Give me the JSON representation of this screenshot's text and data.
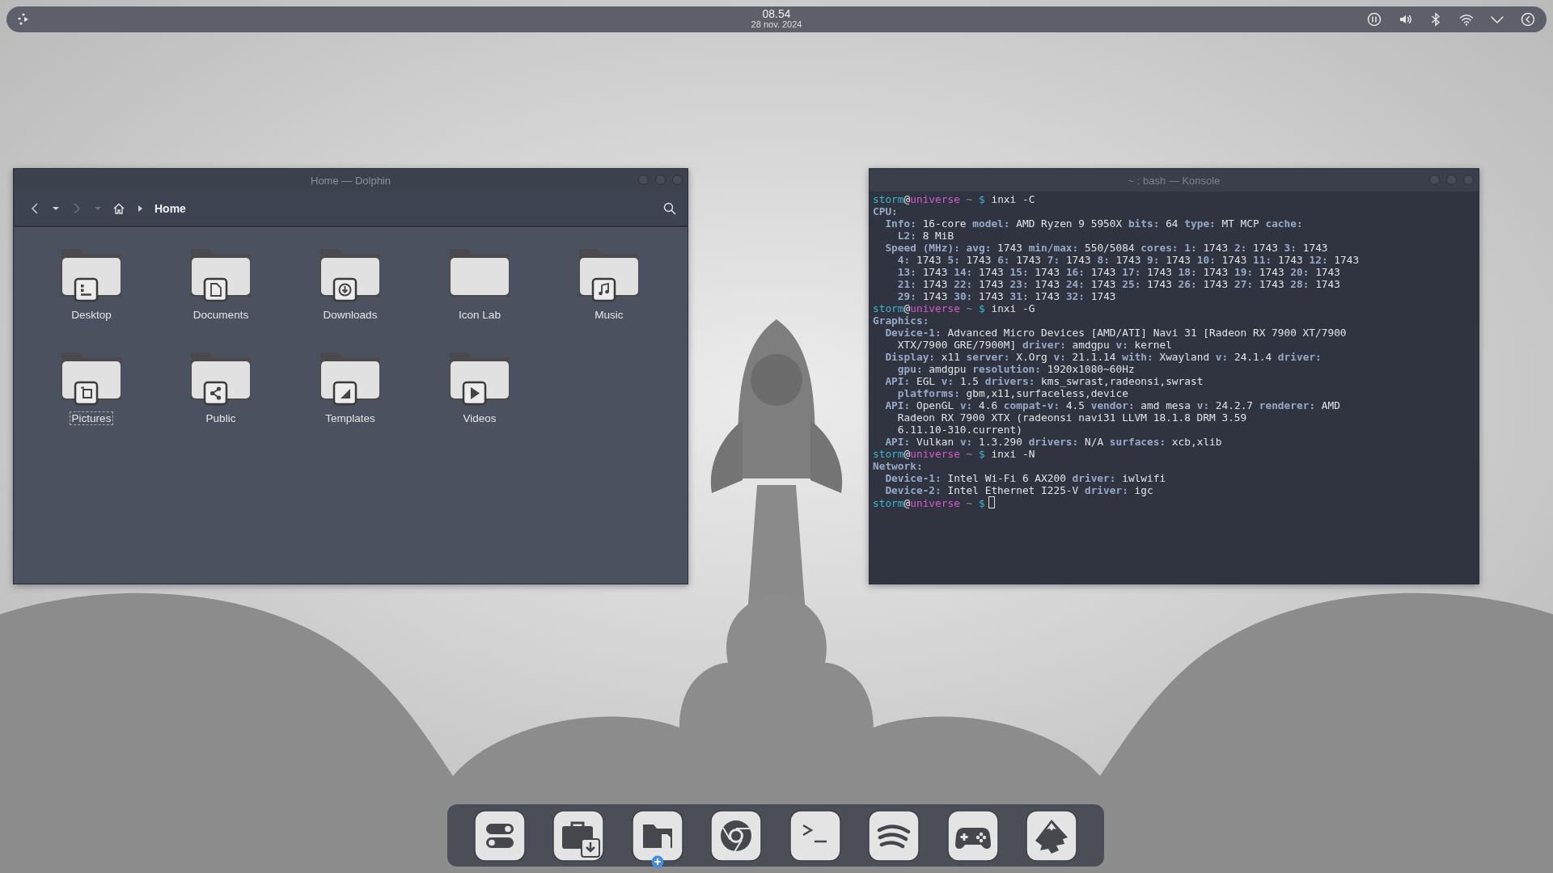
{
  "top_panel": {
    "clock": {
      "time": "08.54",
      "date": "28 nov. 2024"
    }
  },
  "dolphin": {
    "title": "Home — Dolphin",
    "navigation": {
      "back": {
        "disabled": false
      },
      "forward": {
        "disabled": true
      }
    },
    "location": "Home",
    "folders": [
      {
        "label": "Desktop",
        "kind": "desktop",
        "focused": false
      },
      {
        "label": "Documents",
        "kind": "document",
        "focused": false
      },
      {
        "label": "Downloads",
        "kind": "download",
        "focused": false
      },
      {
        "label": "Icon Lab",
        "kind": "plain",
        "focused": false
      },
      {
        "label": "Music",
        "kind": "music",
        "focused": false
      },
      {
        "label": "Pictures",
        "kind": "picture",
        "focused": true
      },
      {
        "label": "Public",
        "kind": "share",
        "focused": false
      },
      {
        "label": "Templates",
        "kind": "template",
        "focused": false
      },
      {
        "label": "Videos",
        "kind": "video",
        "focused": false
      }
    ]
  },
  "konsole": {
    "title": "~ : bash — Konsole",
    "lines": [
      {
        "kind": "prompt",
        "user": "storm",
        "separator": "@",
        "host": "universe",
        "path": "~",
        "symbol": "$",
        "command": "inxi -C",
        "cursor": false
      },
      {
        "kind": "heading",
        "text": "CPU:"
      },
      {
        "kind": "item",
        "text": "**Info:** 16-core **model:** AMD Ryzen 9 5950X **bits:** 64 **type:** MT MCP **cache:**"
      },
      {
        "kind": "continuation",
        "text": "**L2:** 8 MiB"
      },
      {
        "kind": "item",
        "text": "**Speed (MHz):** **avg:** 1743 **min/max:** 550/5084 **cores:** **1:** 1743 **2:** 1743 **3:** 1743"
      },
      {
        "kind": "continuation",
        "text": "**4:** 1743 **5:** 1743 **6:** 1743 **7:** 1743 **8:** 1743 **9:** 1743 **10:** 1743 **11:** 1743 **12:** 1743"
      },
      {
        "kind": "continuation",
        "text": "**13:** 1743 **14:** 1743 **15:** 1743 **16:** 1743 **17:** 1743 **18:** 1743 **19:** 1743 **20:** 1743"
      },
      {
        "kind": "continuation",
        "text": "**21:** 1743 **22:** 1743 **23:** 1743 **24:** 1743 **25:** 1743 **26:** 1743 **27:** 1743 **28:** 1743"
      },
      {
        "kind": "continuation",
        "text": "**29:** 1743 **30:** 1743 **31:** 1743 **32:** 1743"
      },
      {
        "kind": "prompt",
        "user": "storm",
        "separator": "@",
        "host": "universe",
        "path": "~",
        "symbol": "$",
        "command": "inxi -G",
        "cursor": false
      },
      {
        "kind": "heading",
        "text": "Graphics:"
      },
      {
        "kind": "item",
        "text": "**Device-1:** Advanced Micro Devices [AMD/ATI] Navi 31 [Radeon RX 7900 XT/7900"
      },
      {
        "kind": "continuation",
        "text": "XTX/7900 GRE/7900M] **driver:** amdgpu **v:** kernel"
      },
      {
        "kind": "item",
        "text": "**Display:** x11 **server:** X.Org **v:** 21.1.14 **with:** Xwayland **v:** 24.1.4 **driver:**"
      },
      {
        "kind": "continuation",
        "text": "**gpu:** amdgpu **resolution:** 1920x1080~60Hz"
      },
      {
        "kind": "item",
        "text": "**API:** EGL **v:** 1.5 **drivers:** kms_swrast,radeonsi,swrast"
      },
      {
        "kind": "continuation",
        "text": "**platforms:** gbm,x11,surfaceless,device"
      },
      {
        "kind": "item",
        "text": "**API:** OpenGL **v:** 4.6 **compat-v:** 4.5 **vendor:** amd mesa **v:** 24.2.7 **renderer:** AMD"
      },
      {
        "kind": "continuation",
        "text": "Radeon RX 7900 XTX (radeonsi navi31 LLVM 18.1.8 DRM 3.59"
      },
      {
        "kind": "continuation",
        "text": "6.11.10-310.current)"
      },
      {
        "kind": "item",
        "text": "**API:** Vulkan **v:** 1.3.290 **drivers:** N/A **surfaces:** xcb,xlib"
      },
      {
        "kind": "prompt",
        "user": "storm",
        "separator": "@",
        "host": "universe",
        "path": "~",
        "symbol": "$",
        "command": "inxi -N",
        "cursor": false
      },
      {
        "kind": "heading",
        "text": "Network:"
      },
      {
        "kind": "item",
        "text": "**Device-1:** Intel Wi-Fi 6 AX200 **driver:** iwlwifi"
      },
      {
        "kind": "item",
        "text": "**Device-2:** Intel Ethernet I225-V **driver:** igc"
      },
      {
        "kind": "prompt",
        "user": "storm",
        "separator": "@",
        "host": "universe",
        "path": "~",
        "symbol": "$",
        "cursor": true
      }
    ]
  },
  "dock": {
    "items": [
      {
        "kind": "toggles",
        "badge": false
      },
      {
        "kind": "briefcase",
        "badge": false
      },
      {
        "kind": "folder",
        "badge": true
      },
      {
        "kind": "browser",
        "badge": false
      },
      {
        "kind": "terminal",
        "badge": false
      },
      {
        "kind": "waves",
        "badge": false
      },
      {
        "kind": "gamepad",
        "badge": false
      },
      {
        "kind": "mountain",
        "badge": false
      }
    ]
  }
}
